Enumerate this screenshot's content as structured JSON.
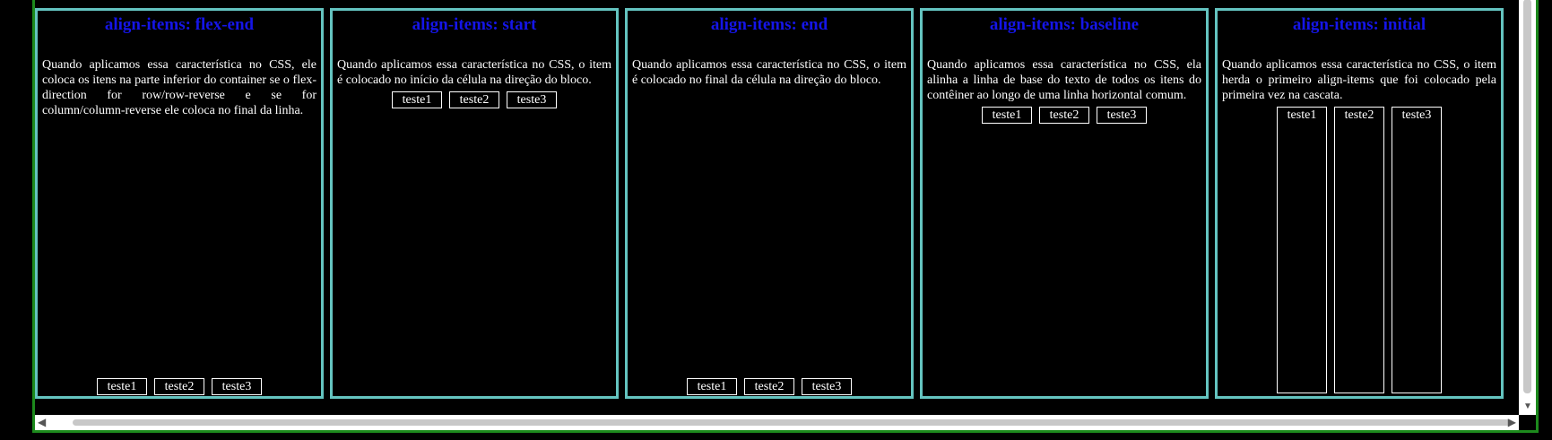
{
  "cards": [
    {
      "title": "align-items: flex-end",
      "text": "Quando aplicamos essa característica no CSS, ele coloca os itens na parte inferior do container se o flex-direction for row/row-reverse e se for column/column-reverse ele coloca no final da linha.",
      "items": [
        "teste1",
        "teste2",
        "teste3"
      ]
    },
    {
      "title": "align-items: start",
      "text": "Quando aplicamos essa característica no CSS, o item é colocado no início da célula na direção do bloco.",
      "items": [
        "teste1",
        "teste2",
        "teste3"
      ]
    },
    {
      "title": "align-items: end",
      "text": "Quando aplicamos essa característica no CSS, o item é colocado no final da célula na direção do bloco.",
      "items": [
        "teste1",
        "teste2",
        "teste3"
      ]
    },
    {
      "title": "align-items: baseline",
      "text": "Quando aplicamos essa característica no CSS, ela alinha a linha de base do texto de todos os itens do contêiner ao longo de uma linha horizontal comum.",
      "items": [
        "teste1",
        "teste2",
        "teste3"
      ]
    },
    {
      "title": "align-items: initial",
      "text": "Quando aplicamos essa característica no CSS, o item herda o primeiro align-items que foi colocado pela primeira vez na cascata.",
      "items": [
        "teste1",
        "teste2",
        "teste3"
      ]
    }
  ],
  "colors": {
    "background": "#000000",
    "title": "#1515e8",
    "card_border": "#64c4c0",
    "frame_border": "#1d8a1d"
  }
}
